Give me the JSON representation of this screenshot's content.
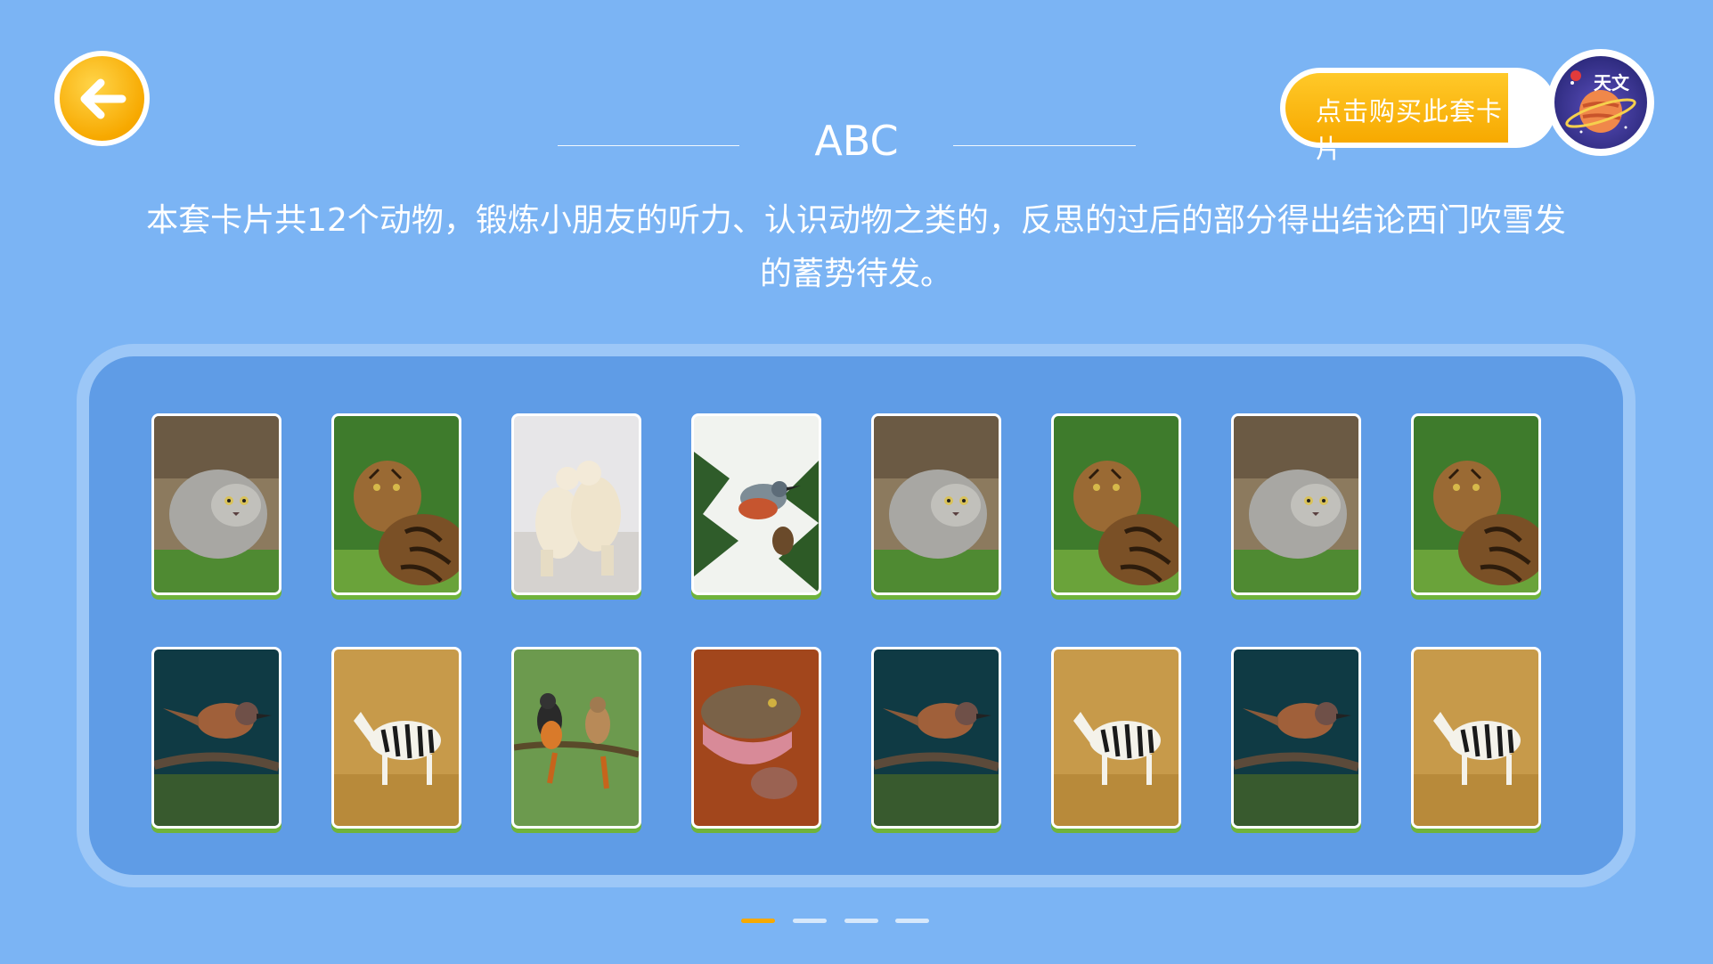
{
  "header": {
    "back_icon": "arrow-left-icon",
    "buy_label": "点击购买此套卡片",
    "logo_text": "天文",
    "logo_icon": "planet-logo-icon"
  },
  "title": "ABC",
  "description": "本套卡片共12个动物，锻炼小朋友的听力、认识动物之类的，反思的过后的部分得出结论西门吹雪发的蓄势待发。",
  "colors": {
    "background": "#7bb4f4",
    "text": "#ffffff",
    "accent": "#f7a900",
    "card_border": "#6fb33b"
  },
  "cards": {
    "row1": [
      {
        "animal": "manul"
      },
      {
        "animal": "clouded-leopard"
      },
      {
        "animal": "polar-bears"
      },
      {
        "animal": "nuthatch"
      },
      {
        "animal": "manul"
      },
      {
        "animal": "clouded-leopard"
      },
      {
        "animal": "manul"
      },
      {
        "animal": "clouded-leopard"
      }
    ],
    "row2": [
      {
        "animal": "jay-bird"
      },
      {
        "animal": "zebra"
      },
      {
        "animal": "redstarts"
      },
      {
        "animal": "snake"
      },
      {
        "animal": "jay-bird"
      },
      {
        "animal": "zebra"
      },
      {
        "animal": "jay-bird"
      },
      {
        "animal": "zebra"
      }
    ]
  },
  "pager": {
    "pages": 4,
    "active": 1
  }
}
